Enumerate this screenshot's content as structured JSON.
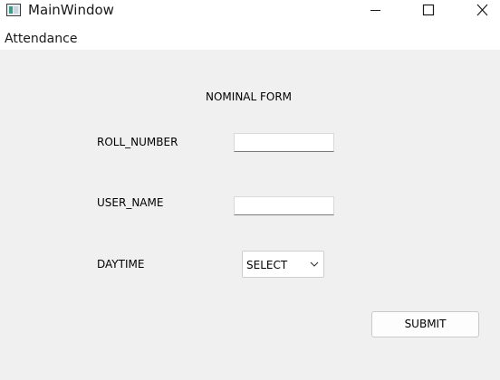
{
  "window": {
    "title": "MainWindow",
    "controls": {
      "minimize_icon": "minimize-icon",
      "maximize_icon": "maximize-icon",
      "close_icon": "close-icon"
    }
  },
  "menubar": {
    "items": [
      {
        "label": "Attendance"
      }
    ]
  },
  "form": {
    "title": "NOMINAL FORM",
    "fields": {
      "roll_number": {
        "label": "ROLL_NUMBER",
        "value": ""
      },
      "user_name": {
        "label": "USER_NAME",
        "value": ""
      },
      "daytime": {
        "label": "DAYTIME",
        "selected": "SELECT"
      }
    },
    "submit_label": "SUBMIT"
  },
  "colors": {
    "window_background": "#f0f0f0",
    "titlebar_background": "#ffffff",
    "field_background": "#ffffff"
  }
}
